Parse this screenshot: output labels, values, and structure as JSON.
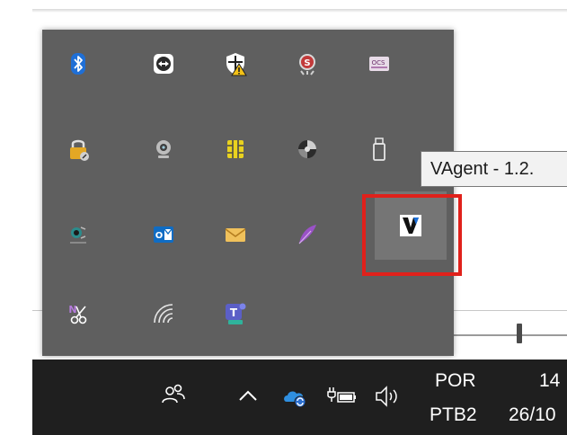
{
  "tooltip": {
    "text": "VAgent - 1.2."
  },
  "tray_icons": [
    {
      "row": 1,
      "col": 1,
      "icon": "bluetooth-icon"
    },
    {
      "row": 1,
      "col": 2,
      "icon": "teamviewer-icon"
    },
    {
      "row": 1,
      "col": 3,
      "icon": "windows-security-warning-icon"
    },
    {
      "row": 1,
      "col": 4,
      "icon": "s-app-icon"
    },
    {
      "row": 1,
      "col": 5,
      "icon": "ocs-app-icon"
    },
    {
      "row": 2,
      "col": 1,
      "icon": "lock-computer-icon"
    },
    {
      "row": 2,
      "col": 2,
      "icon": "webcam-icon"
    },
    {
      "row": 2,
      "col": 3,
      "icon": "smart-card-chip-icon"
    },
    {
      "row": 2,
      "col": 4,
      "icon": "gray-sphere-icon"
    },
    {
      "row": 2,
      "col": 5,
      "icon": "usb-drive-icon"
    },
    {
      "row": 3,
      "col": 1,
      "icon": "logitech-icon"
    },
    {
      "row": 3,
      "col": 2,
      "icon": "outlook-icon"
    },
    {
      "row": 3,
      "col": 3,
      "icon": "mail-envelope-icon"
    },
    {
      "row": 3,
      "col": 4,
      "icon": "purple-feather-icon"
    },
    {
      "row": 3,
      "col": 5,
      "icon": "vagent-icon"
    },
    {
      "row": 4,
      "col": 1,
      "icon": "onenote-clipper-icon"
    },
    {
      "row": 4,
      "col": 2,
      "icon": "wifi-icon"
    },
    {
      "row": 4,
      "col": 3,
      "icon": "teams-new-icon"
    }
  ],
  "taskbar": {
    "people_icon": "people-icon",
    "chevron_icon": "chevron-up-icon",
    "onedrive_icon": "onedrive-sync-icon",
    "power_icon": "battery-plug-icon",
    "volume_icon": "speaker-icon",
    "language_top": "POR",
    "language_bottom": "PTB2",
    "time": "14",
    "date": "26/10"
  },
  "colors": {
    "flyout_bg": "#5f5f5f",
    "taskbar_bg": "#1f1f1f",
    "highlight": "#e0211b"
  }
}
